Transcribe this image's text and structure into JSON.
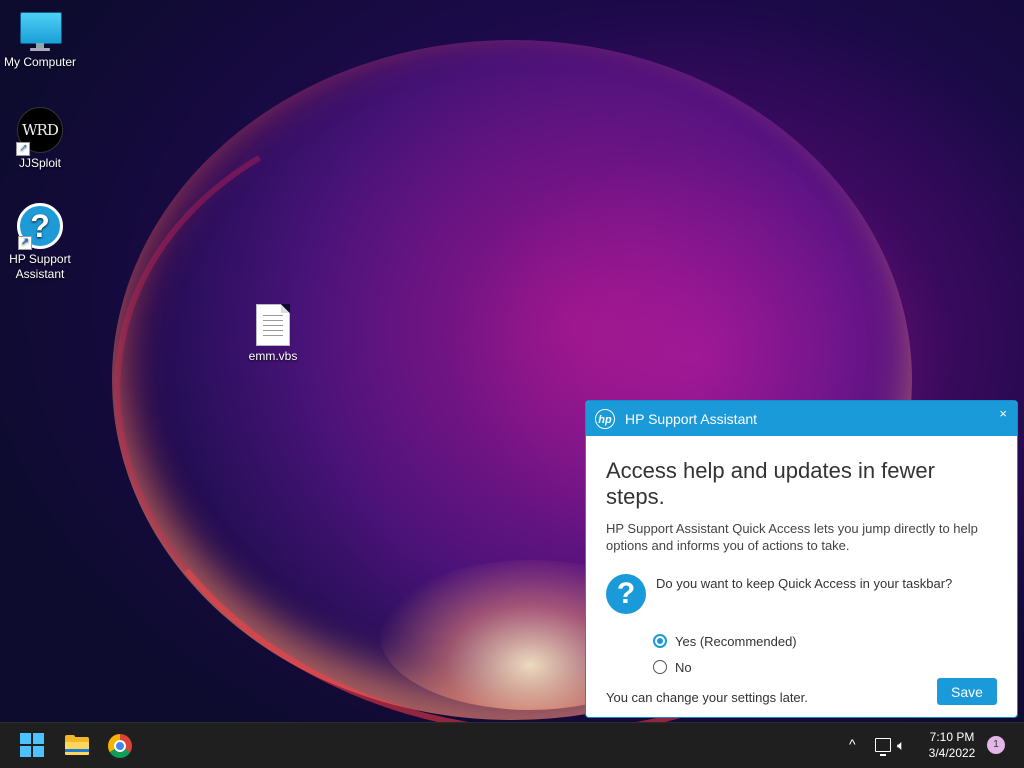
{
  "desktop": {
    "icons": [
      {
        "label": "My Computer"
      },
      {
        "label": "JJSploit",
        "icon_text": "WRD"
      },
      {
        "label": "HP Support Assistant"
      },
      {
        "label": "emm.vbs"
      }
    ]
  },
  "popup": {
    "title": "HP Support Assistant",
    "logo_text": "hp",
    "close_glyph": "×",
    "headline": "Access help and updates in fewer steps.",
    "description": "HP Support Assistant Quick Access lets you jump directly to help options and informs you of actions to take.",
    "question_glyph": "?",
    "question": "Do you want to keep Quick Access in your taskbar?",
    "options": [
      {
        "label": "Yes (Recommended)",
        "selected": true
      },
      {
        "label": "No",
        "selected": false
      }
    ],
    "note": "You can change your settings later.",
    "save_label": "Save",
    "accent_color": "#1a9ad8"
  },
  "taskbar": {
    "pinned": [
      "start-icon",
      "file-explorer-icon",
      "chrome-icon"
    ],
    "tray": {
      "chevron_glyph": "^",
      "time": "7:10 PM",
      "date": "3/4/2022",
      "notification_count": "1"
    }
  }
}
